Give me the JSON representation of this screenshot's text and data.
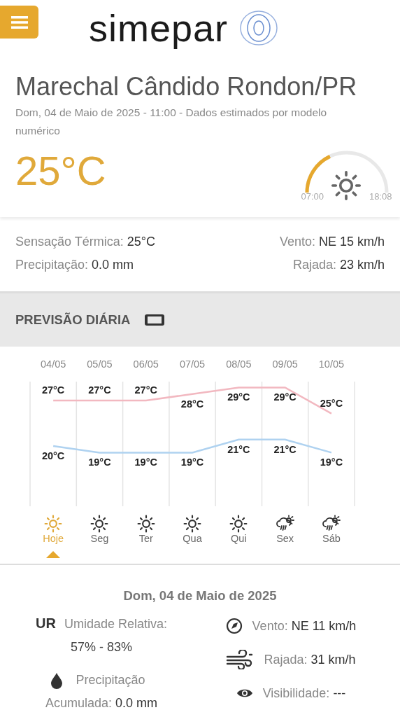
{
  "header": {
    "logo": "simepar"
  },
  "location": {
    "title": "Marechal Cândido Rondon/PR",
    "subtitle": "Dom, 04 de Maio de 2025 - 11:00 - Dados estimados por modelo numérico",
    "temperature": "25°C",
    "sun": {
      "sunrise": "07:00",
      "sunset": "18:08"
    }
  },
  "conditions": [
    {
      "label": "Sensação Térmica:",
      "value": "25°C"
    },
    {
      "label": "Vento:",
      "value": "NE 15 km/h"
    },
    {
      "label": "Precipitação:",
      "value": "0.0 mm"
    },
    {
      "label": "Rajada:",
      "value": "23 km/h"
    }
  ],
  "forecast": {
    "title": "PREVISÃO DIÁRIA",
    "days": [
      {
        "date": "04/05",
        "max": "27°C",
        "min": "20°C",
        "day": "Hoje",
        "kind": "sun",
        "selected": true
      },
      {
        "date": "05/05",
        "max": "27°C",
        "min": "19°C",
        "day": "Seg",
        "kind": "sun",
        "selected": false
      },
      {
        "date": "06/05",
        "max": "27°C",
        "min": "19°C",
        "day": "Ter",
        "kind": "sun",
        "selected": false
      },
      {
        "date": "07/05",
        "max": "28°C",
        "min": "19°C",
        "day": "Qua",
        "kind": "sun",
        "selected": false
      },
      {
        "date": "08/05",
        "max": "29°C",
        "min": "21°C",
        "day": "Qui",
        "kind": "sun",
        "selected": false
      },
      {
        "date": "09/05",
        "max": "29°C",
        "min": "21°C",
        "day": "Sex",
        "kind": "rain",
        "selected": false
      },
      {
        "date": "10/05",
        "max": "25°C",
        "min": "19°C",
        "day": "Sáb",
        "kind": "rain",
        "selected": false
      }
    ]
  },
  "detail": {
    "date": "Dom, 04 de Maio de 2025",
    "left": [
      {
        "kind": "humidity",
        "badge": "UR",
        "label": "Umidade Relativa:",
        "value": "57% - 83%"
      },
      {
        "kind": "precipitation",
        "title": "Precipitação",
        "label": "Acumulada:",
        "value": "0.0 mm"
      }
    ],
    "right": [
      {
        "kind": "wind",
        "label": "Vento:",
        "value": "NE 11 km/h"
      },
      {
        "kind": "gust",
        "label": "Rajada:",
        "value": "31 km/h"
      },
      {
        "kind": "visibility",
        "label": "Visibilidade:",
        "value": "---"
      }
    ]
  }
}
